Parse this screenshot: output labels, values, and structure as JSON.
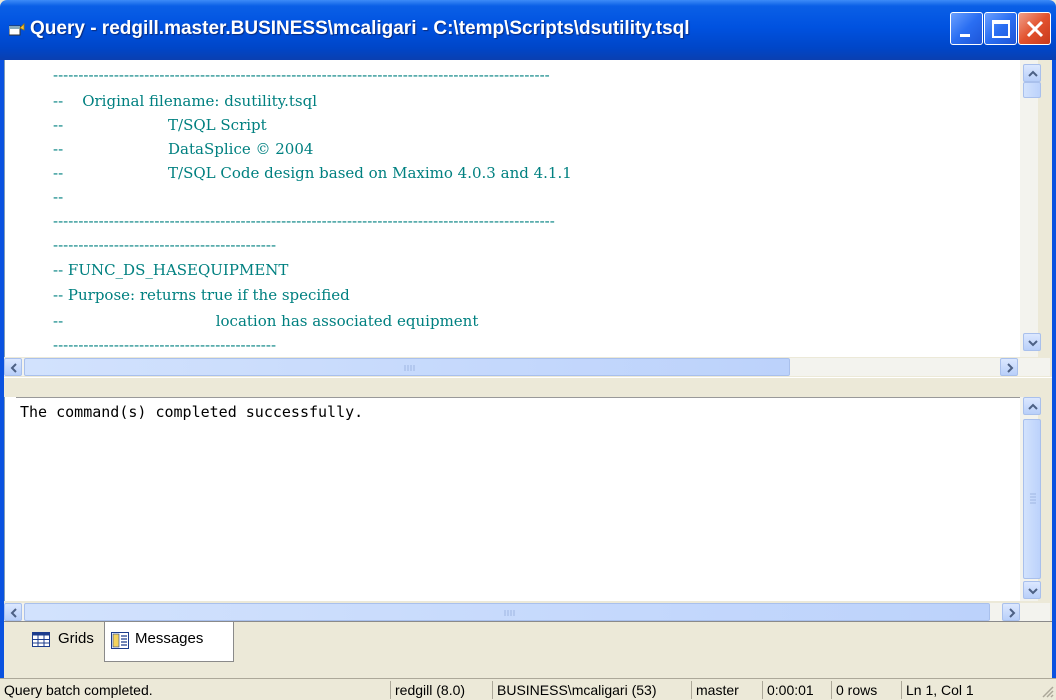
{
  "window": {
    "title": "Query - redgill.master.BUSINESS\\mcaligari - C:\\temp\\Scripts\\dsutility.tsql",
    "icon": "query-window-icon",
    "controls": [
      "minimize-icon",
      "maximize-icon",
      "close-icon"
    ]
  },
  "editor": {
    "lines": [
      "--------------------------------------------------------------------------------------------------",
      "--    Original filename: dsutility.tsql",
      "--                      T/SQL Script",
      "--                      DataSplice © 2004",
      "--                      T/SQL Code design based on Maximo 4.0.3 and 4.1.1",
      "--",
      "---------------------------------------------------------------------------------------------------",
      "--------------------------------------------",
      "-- FUNC_DS_HASEQUIPMENT",
      "-- Purpose: returns true if the specified",
      "--                                location has associated equipment",
      "--------------------------------------------"
    ],
    "text_color": "#008080"
  },
  "results": {
    "message": "The command(s) completed successfully."
  },
  "tabs": [
    {
      "label": "Grids",
      "icon": "grid-icon",
      "active": false
    },
    {
      "label": "Messages",
      "icon": "messages-icon",
      "active": true
    }
  ],
  "status": {
    "message": "Query batch completed.",
    "server": "redgill (8.0)",
    "login": "BUSINESS\\mcaligari (53)",
    "database": "master",
    "elapsed": "0:00:01",
    "rows": "0 rows",
    "position": "Ln 1, Col 1"
  },
  "colors": {
    "titlebar": "#0052e0",
    "close_button": "#e2522e",
    "code_comment": "#008080"
  }
}
